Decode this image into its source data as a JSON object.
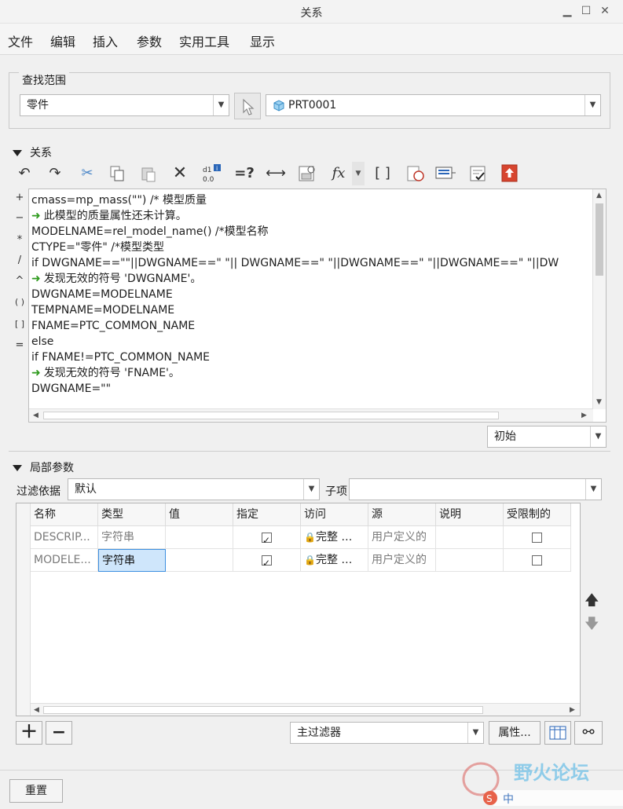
{
  "window": {
    "title": "关系"
  },
  "menu": [
    "文件",
    "编辑",
    "插入",
    "参数",
    "实用工具",
    "显示"
  ],
  "search_scope": {
    "label": "查找范围",
    "type_value": "零件",
    "model_value": "PRT0001"
  },
  "relations": {
    "header": "关系",
    "toolbar_icons": [
      "undo-icon",
      "redo-icon",
      "cut-icon",
      "copy-icon",
      "paste-icon",
      "delete-icon",
      "sort-icon",
      "verify-icon",
      "measure-icon",
      "show-values-icon",
      "function-icon",
      "brackets-icon",
      "evaluate-icon",
      "execute-icon",
      "check-icon",
      "export-icon"
    ],
    "side_ops": [
      "+",
      "−",
      "*",
      "/",
      "^",
      "( )",
      "[ ]",
      "="
    ],
    "lines": [
      {
        "text": "cmass=mp_mass(\"\")  /* 模型质量",
        "msg": false
      },
      {
        "text": "此模型的质量属性还未计算。",
        "msg": true
      },
      {
        "text": "MODELNAME=rel_model_name()  /*模型名称",
        "msg": false
      },
      {
        "text": "CTYPE=\"零件\" /*模型类型",
        "msg": false
      },
      {
        "text": "if DWGNAME==\"\"||DWGNAME==\" \"|| DWGNAME==\"  \"||DWGNAME==\"   \"||DWGNAME==\"    \"||DW",
        "msg": false
      },
      {
        "text": "发现无效的符号 'DWGNAME'。",
        "msg": true
      },
      {
        "text": "DWGNAME=MODELNAME",
        "msg": false
      },
      {
        "text": "TEMPNAME=MODELNAME",
        "msg": false
      },
      {
        "text": "FNAME=PTC_COMMON_NAME",
        "msg": false
      },
      {
        "text": "else",
        "msg": false
      },
      {
        "text": "if FNAME!=PTC_COMMON_NAME",
        "msg": false
      },
      {
        "text": "发现无效的符号 'FNAME'。",
        "msg": true
      },
      {
        "text": "DWGNAME=\"\"",
        "msg": false
      }
    ],
    "units_value": "初始"
  },
  "local_params": {
    "header": "局部参数",
    "filter_label": "过滤依据",
    "filter_value": "默认",
    "child_label": "子项",
    "child_value": "",
    "columns": [
      "名称",
      "类型",
      "值",
      "指定",
      "访问",
      "源",
      "说明",
      "受限制的"
    ],
    "rows": [
      {
        "name": "DESCRIP...",
        "type": "字符串",
        "value": "",
        "designated": true,
        "access": "完整",
        "source": "用户定义的",
        "description": "",
        "restricted": false
      },
      {
        "name": "MODELE...",
        "type": "字符串",
        "value": "",
        "designated": true,
        "access": "完整",
        "source": "用户定义的",
        "description": "",
        "restricted": false
      }
    ],
    "main_filter": "主过滤器",
    "properties_btn": "属性..."
  },
  "footer": {
    "reset": "重置"
  },
  "watermark": {
    "text": "野火论坛"
  }
}
